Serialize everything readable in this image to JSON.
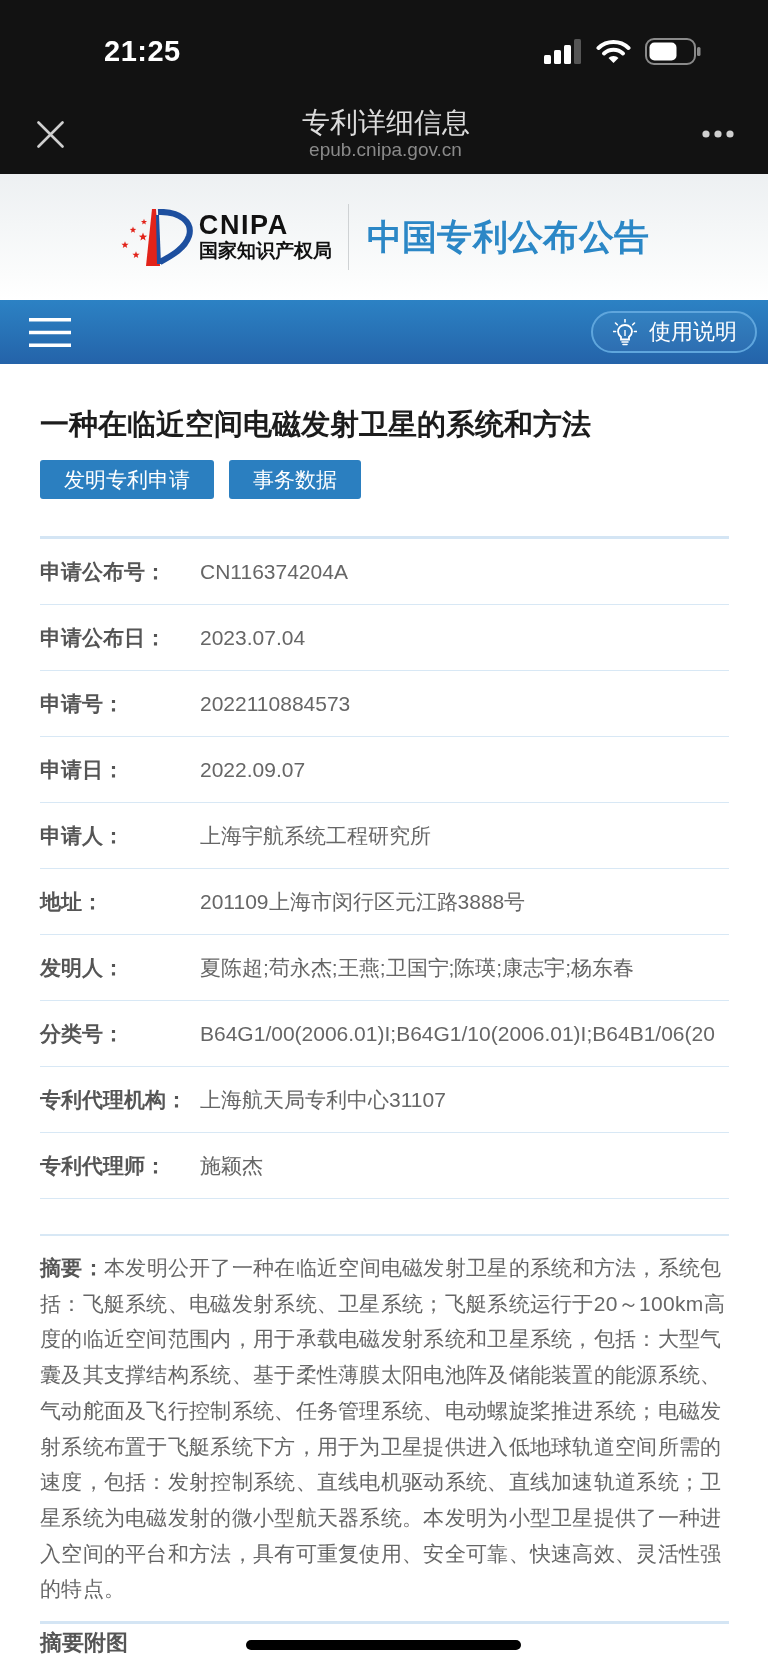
{
  "status_bar": {
    "time": "21:25"
  },
  "nav_bar": {
    "title": "专利详细信息",
    "url": "epub.cnipa.gov.cn"
  },
  "site_header": {
    "logo_abbr": "CNIPA",
    "logo_name": "国家知识产权局",
    "title": "中国专利公布公告"
  },
  "menu_bar": {
    "help_button": "使用说明"
  },
  "patent": {
    "title": "一种在临近空间电磁发射卫星的系统和方法",
    "buttons": [
      "发明专利申请",
      "事务数据"
    ],
    "fields": [
      {
        "label": "申请公布号：",
        "value": "CN116374204A"
      },
      {
        "label": "申请公布日：",
        "value": "2023.07.04"
      },
      {
        "label": "申请号：",
        "value": "2022110884573"
      },
      {
        "label": "申请日：",
        "value": "2022.09.07"
      },
      {
        "label": "申请人：",
        "value": "上海宇航系统工程研究所"
      },
      {
        "label": "地址：",
        "value": "201109上海市闵行区元江路3888号"
      },
      {
        "label": "发明人：",
        "value": "夏陈超;苟永杰;王燕;卫国宁;陈瑛;康志宇;杨东春"
      },
      {
        "label": "分类号：",
        "value": "B64G1/00(2006.01)I;B64G1/10(2006.01)I;B64B1/06(20"
      },
      {
        "label": "专利代理机构：",
        "value": "上海航天局专利中心31107"
      },
      {
        "label": "专利代理师：",
        "value": "施颖杰"
      }
    ],
    "abstract": "**摘要：**本发明公开了一种在临近空间电磁发射卫星的系统和方法，系统包括：飞艇系统、电磁发射系统、卫星系统；飞艇系统运行于20～100km高度的临近空间范围内，用于承载电磁发射系统和卫星系统，包括：大型气囊及其支撑结构系统、基于柔性薄膜太阳电池阵及储能装置的能源系统、气动舵面及飞行控制系统、任务管理系统、电动螺旋桨推进系统；电磁发射系统布置于飞艇系统下方，用于为卫星提供进入低地球轨道空间所需的速度，包括：发射控制系统、直线电机驱动系统、直线加速轨道系统；卫星系统为电磁发射的微小型航天器系统。本发明为小型卫星提供了一种进入空间的平台和方法，具有可重复使用、安全可靠、快速高效、灵活性强的特点。",
    "abstract_figure_heading": "摘要附图"
  }
}
